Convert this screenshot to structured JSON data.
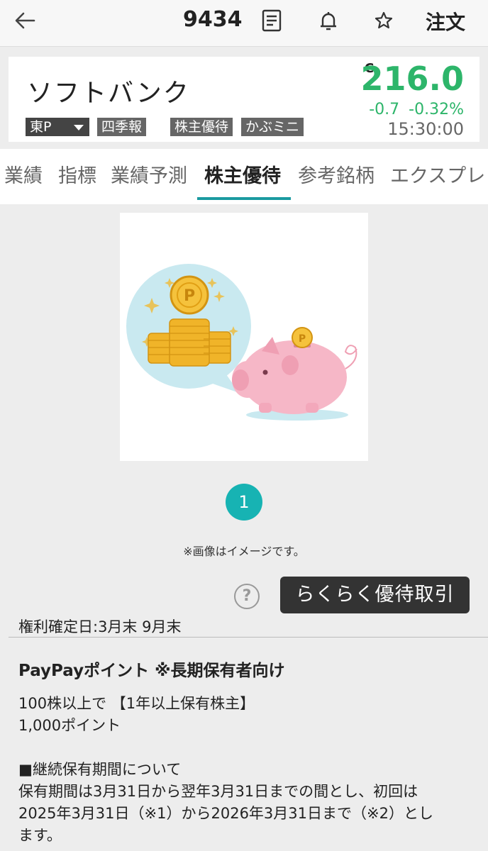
{
  "appbar": {
    "code": "9434",
    "order_label": "注文",
    "icons": [
      "back-arrow-icon",
      "document-icon",
      "bell-icon",
      "star-icon"
    ]
  },
  "stock": {
    "name": "ソフトバンク",
    "market": "東P",
    "tags": [
      "四季報",
      "株主優待",
      "かぶミニ"
    ],
    "close_flag": "C",
    "price": "216.0",
    "change": "-0.7",
    "change_pct": "-0.32%",
    "time": "15:30:00",
    "price_color": "#2db56a"
  },
  "tabs": [
    "業績",
    "指標",
    "業績予測",
    "株主優待",
    "参考銘柄",
    "エクスプレ"
  ],
  "active_tab": "株主優待",
  "accent_color": "#1a9aa0",
  "carousel": {
    "current_page": "1"
  },
  "image_note": "※画像はイメージです。",
  "easy_button_label": "らくらく優待取引",
  "help_label": "?",
  "record_date": "権利確定日:3月末 9月末",
  "benefit": {
    "title": "PayPayポイント ※長期保有者向け",
    "line1": "100株以上で 【1年以上保有株主】",
    "line2": "1,000ポイント",
    "section_heading": "■継続保有期間について",
    "para1": "保有期間は3月31日から翌年3月31日までの間とし、初回は",
    "para2": "2025年3月31日（※1）から2026年3月31日まで（※2）とし",
    "para3": "ます。"
  }
}
